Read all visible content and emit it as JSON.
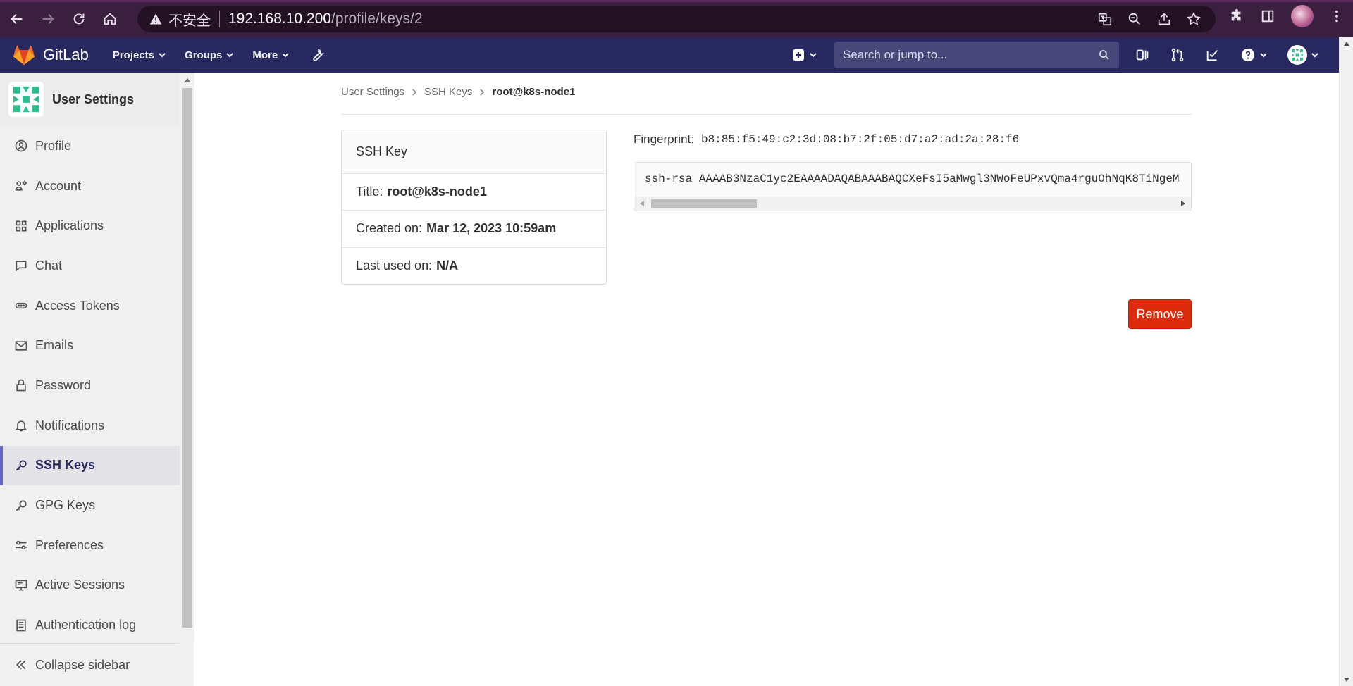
{
  "browser": {
    "insecure_label": "不安全",
    "url_host": "192.168.10.200",
    "url_path": "/profile/keys/2"
  },
  "header": {
    "logo_text": "GitLab",
    "nav": [
      {
        "label": "Projects"
      },
      {
        "label": "Groups"
      },
      {
        "label": "More"
      }
    ],
    "search_placeholder": "Search or jump to..."
  },
  "sidebar": {
    "context_title": "User Settings",
    "items": [
      {
        "label": "Profile",
        "icon": "profile-icon"
      },
      {
        "label": "Account",
        "icon": "account-icon"
      },
      {
        "label": "Applications",
        "icon": "applications-icon"
      },
      {
        "label": "Chat",
        "icon": "chat-icon"
      },
      {
        "label": "Access Tokens",
        "icon": "token-icon"
      },
      {
        "label": "Emails",
        "icon": "mail-icon"
      },
      {
        "label": "Password",
        "icon": "lock-icon"
      },
      {
        "label": "Notifications",
        "icon": "bell-icon"
      },
      {
        "label": "SSH Keys",
        "icon": "key-icon",
        "active": true
      },
      {
        "label": "GPG Keys",
        "icon": "key-icon"
      },
      {
        "label": "Preferences",
        "icon": "preferences-icon"
      },
      {
        "label": "Active Sessions",
        "icon": "monitor-icon"
      },
      {
        "label": "Authentication log",
        "icon": "log-icon"
      }
    ],
    "collapse_label": "Collapse sidebar"
  },
  "breadcrumb": {
    "items": [
      "User Settings",
      "SSH Keys",
      "root@k8s-node1"
    ]
  },
  "key_card": {
    "heading": "SSH Key",
    "title_label": "Title:",
    "title_value": "root@k8s-node1",
    "created_label": "Created on:",
    "created_value": "Mar 12, 2023 10:59am",
    "last_used_label": "Last used on:",
    "last_used_value": "N/A"
  },
  "fingerprint": {
    "label": "Fingerprint:",
    "value": "b8:85:f5:49:c2:3d:08:b7:2f:05:d7:a2:ad:2a:28:f6"
  },
  "key_text": "ssh-rsa AAAAB3NzaC1yc2EAAAADAQABAAABAQCXeFsI5aMwgl3NWoFeUPxvQma4rguOhNqK8TiNgeM",
  "remove_label": "Remove",
  "colors": {
    "header_bg": "#292961",
    "remove_bg": "#dd2b0e",
    "active_accent": "#6666c4"
  }
}
